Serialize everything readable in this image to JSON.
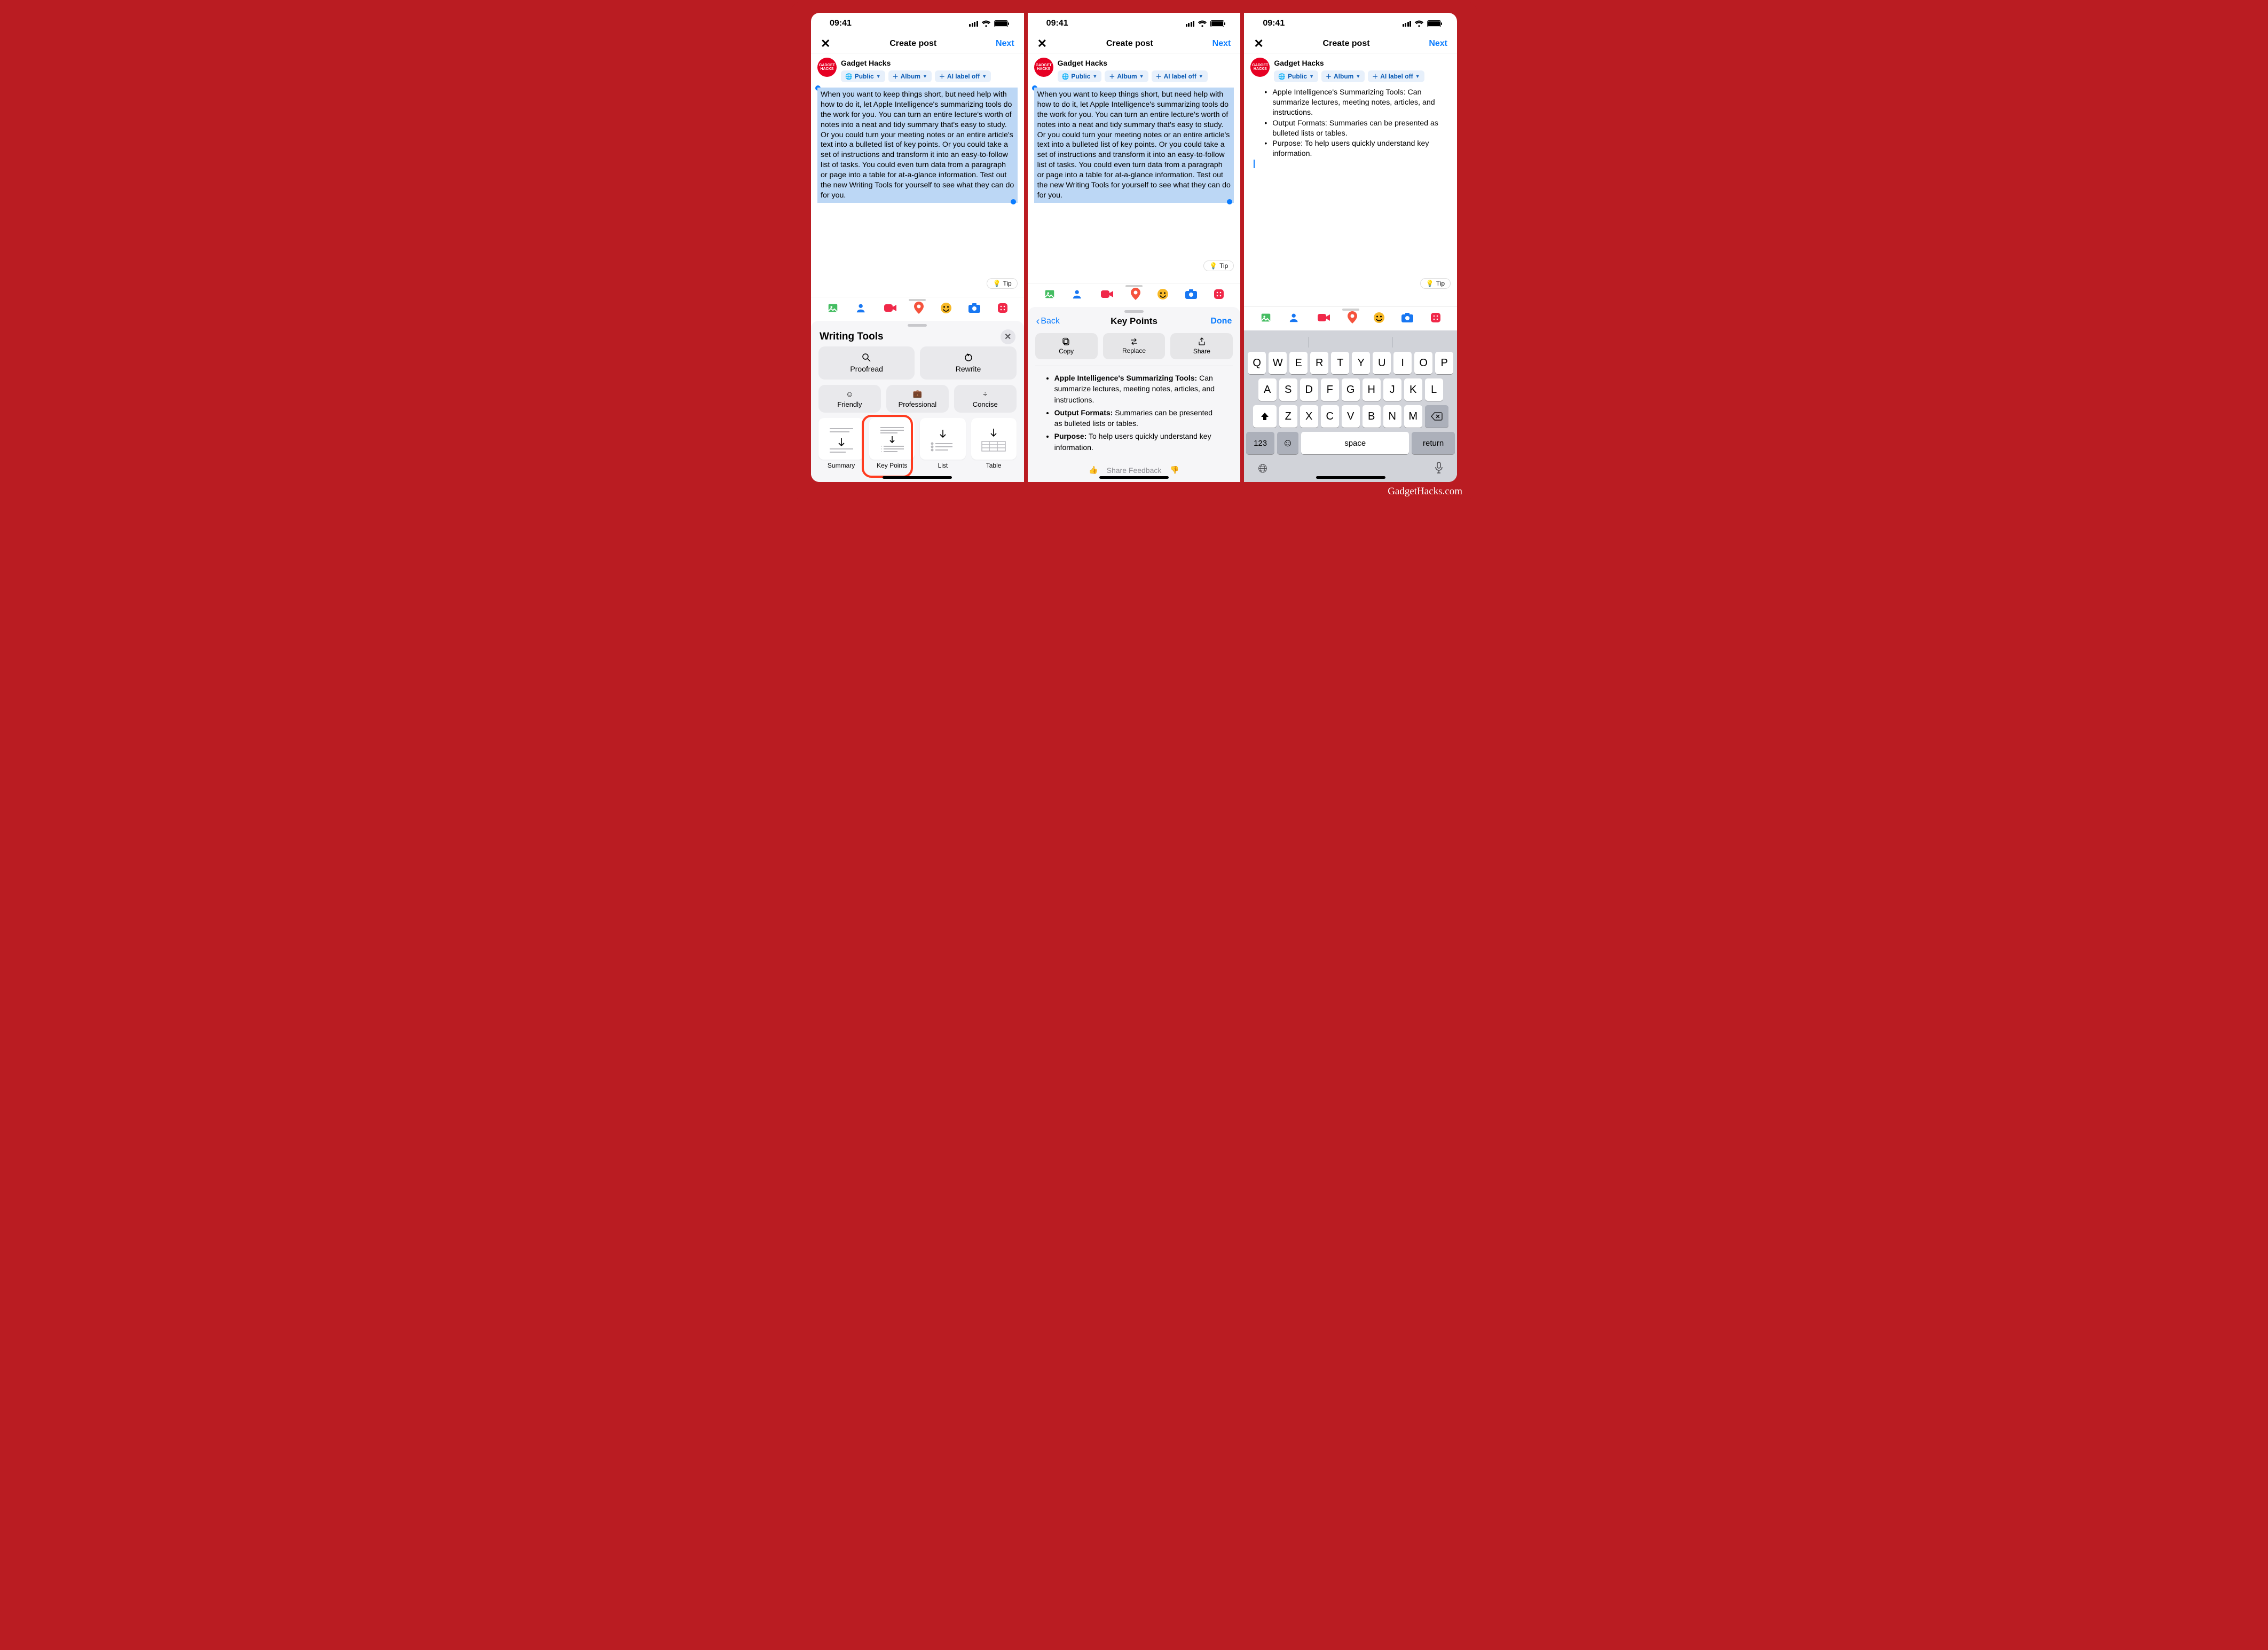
{
  "watermark": "GadgetHacks.com",
  "status": {
    "time": "09:41"
  },
  "nav": {
    "close": "✕",
    "title": "Create post",
    "next": "Next"
  },
  "profile": {
    "name": "Gadget Hacks",
    "avatar_text": "GADGET HACKS"
  },
  "chips": {
    "public": "Public",
    "album": "Album",
    "ailabel": "AI label off"
  },
  "paragraph": "When you want to keep things short, but need help with how to do it, let Apple Intelligence's summarizing tools do the work for you. You can turn an entire lecture's worth of notes into a neat and tidy summary that's easy to study. Or you could turn your meeting notes or an entire article's text into a bulleted list of key points. Or you could take a set of instructions and transform it into an easy-to-follow list of tasks. You could even turn data from a paragraph or page into a table for at-a-glance information. Test out the new Writing Tools for yourself to see what they can do for you.",
  "tip": "Tip",
  "writing_tools": {
    "title": "Writing Tools",
    "proofread": "Proofread",
    "rewrite": "Rewrite",
    "friendly": "Friendly",
    "professional": "Professional",
    "concise": "Concise",
    "tiles": [
      "Summary",
      "Key Points",
      "List",
      "Table"
    ]
  },
  "kp_sheet": {
    "back": "Back",
    "title": "Key Points",
    "done": "Done",
    "actions": {
      "copy": "Copy",
      "replace": "Replace",
      "share": "Share"
    },
    "items": [
      {
        "bold": "Apple Intelligence's Summarizing Tools:",
        "rest": " Can summarize lectures, meeting notes, articles, and instructions."
      },
      {
        "bold": "Output Formats:",
        "rest": " Summaries can be presented as bulleted lists or tables."
      },
      {
        "bold": "Purpose:",
        "rest": " To help users quickly understand key information."
      }
    ],
    "feedback": "Share Feedback"
  },
  "result_bullets": [
    "Apple Intelligence's Summarizing Tools: Can summarize lectures, meeting notes, articles, and instructions.",
    "Output Formats: Summaries can be presented as bulleted lists or tables.",
    "Purpose: To help users quickly understand key information."
  ],
  "keyboard": {
    "row1": [
      "Q",
      "W",
      "E",
      "R",
      "T",
      "Y",
      "U",
      "I",
      "O",
      "P"
    ],
    "row2": [
      "A",
      "S",
      "D",
      "F",
      "G",
      "H",
      "J",
      "K",
      "L"
    ],
    "row3": [
      "Z",
      "X",
      "C",
      "V",
      "B",
      "N",
      "M"
    ],
    "num": "123",
    "space": "space",
    "return": "return"
  }
}
